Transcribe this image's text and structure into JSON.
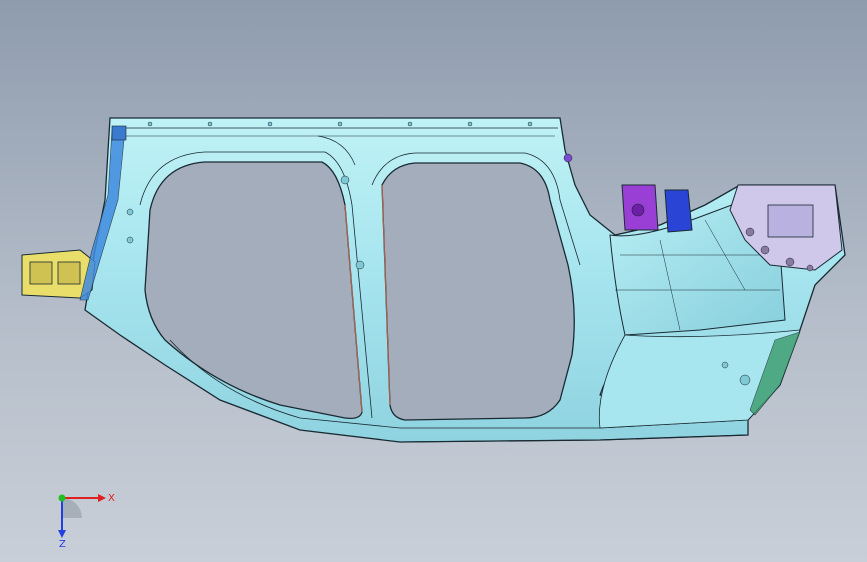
{
  "viewport": {
    "background_top": "#8f9cae",
    "background_bottom": "#c9cfd8"
  },
  "model": {
    "panel_color": "#a9e8f0",
    "edge_color": "#1a2a33",
    "bracket_front_color": "#e9de6a",
    "bracket_purple_color": "#9a3fd6",
    "bracket_blue_color": "#2a45d6",
    "rear_plate_color": "#cfc8ea"
  },
  "triad": {
    "x_label": "X",
    "z_label": "Z",
    "x_color": "#e02020",
    "y_color": "#20c020",
    "z_color": "#2040e0"
  }
}
